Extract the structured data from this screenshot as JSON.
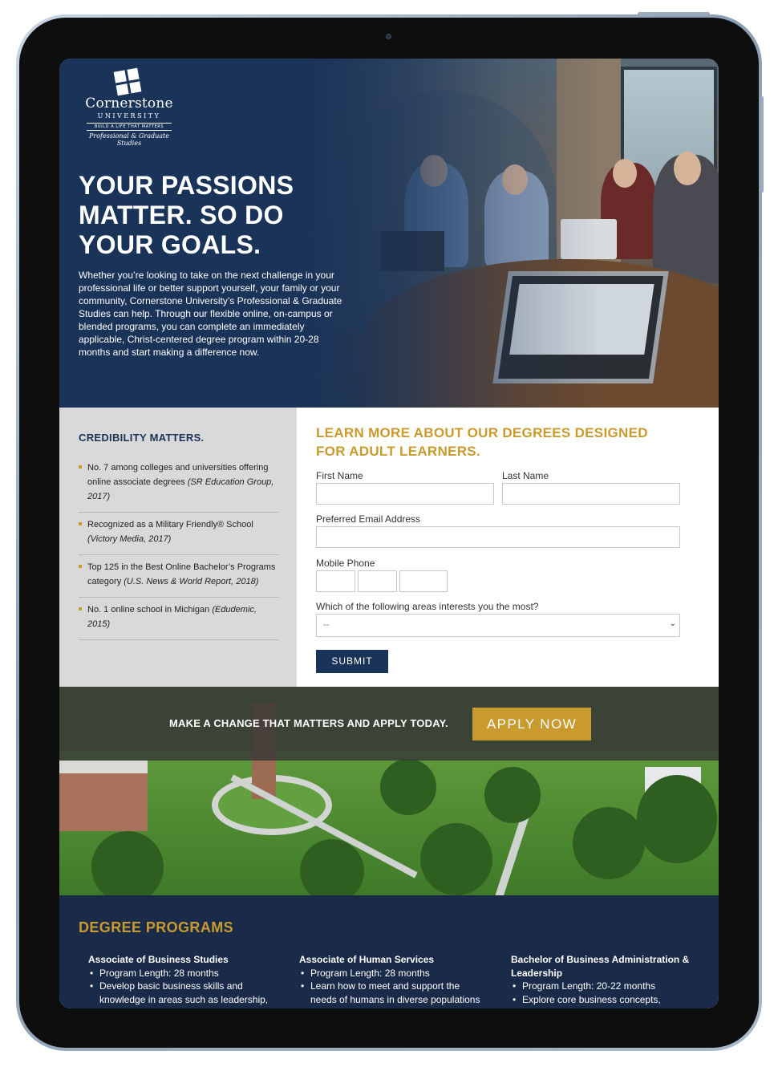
{
  "brand": {
    "name": "Cornerstone",
    "sub": "UNIVERSITY",
    "tagline": "BUILD A LIFE THAT MATTERS",
    "division": "Professional & Graduate Studies"
  },
  "hero": {
    "title_lines": [
      "YOUR PASSIONS",
      "MATTER. SO DO",
      "YOUR GOALS."
    ],
    "body": "Whether you’re looking to take on the next challenge in your professional life or better support yourself, your family or your community, Cornerstone University’s Professional & Graduate Studies can help. Through our flexible online, on-campus or blended programs, you can complete an immediately applicable, Christ-centered degree program within 20-28 months and start making a difference now."
  },
  "credibility": {
    "title": "CREDIBILITY MATTERS.",
    "items": [
      {
        "text": "No. 7 among colleges and universities offering online associate degrees ",
        "source": "(SR Education Group, 2017)"
      },
      {
        "text": "Recognized as a Military Friendly® School ",
        "source": "(Victory Media, 2017)"
      },
      {
        "text": "Top 125 in the Best Online Bachelor’s Programs category ",
        "source": "(U.S. News & World Report, 2018)"
      },
      {
        "text": "No. 1 online school in Michigan ",
        "source": "(Edudemic, 2015)"
      }
    ]
  },
  "form": {
    "title": "LEARN MORE ABOUT OUR DEGREES DESIGNED FOR ADULT LEARNERS.",
    "first_name_label": "First Name",
    "last_name_label": "Last Name",
    "email_label": "Preferred Email Address",
    "phone_label": "Mobile Phone",
    "interest_label": "Which of the following areas interests you the most?",
    "interest_selected": "--",
    "submit_label": "SUBMIT"
  },
  "apply": {
    "text": "MAKE A CHANGE THAT MATTERS AND APPLY TODAY.",
    "button": "APPLY NOW"
  },
  "degrees": {
    "title": "DEGREE PROGRAMS",
    "programs": [
      {
        "name": "Associate of Business Studies",
        "bullets": [
          "Program Length: 28 months",
          "Develop basic business skills and knowledge in areas such as leadership,"
        ]
      },
      {
        "name": "Associate of Human Services",
        "bullets": [
          "Program Length: 28 months",
          "Learn how to meet and support the needs of humans in diverse populations"
        ]
      },
      {
        "name": "Bachelor of Business Administration & Leadership",
        "bullets": [
          "Program Length: 20-22 months",
          "Explore core business concepts,"
        ]
      }
    ]
  },
  "colors": {
    "navy": "#1a3358",
    "gold": "#c99a2e",
    "gray_panel": "#d9d9d9",
    "dark_navy": "#1a2b4a"
  }
}
